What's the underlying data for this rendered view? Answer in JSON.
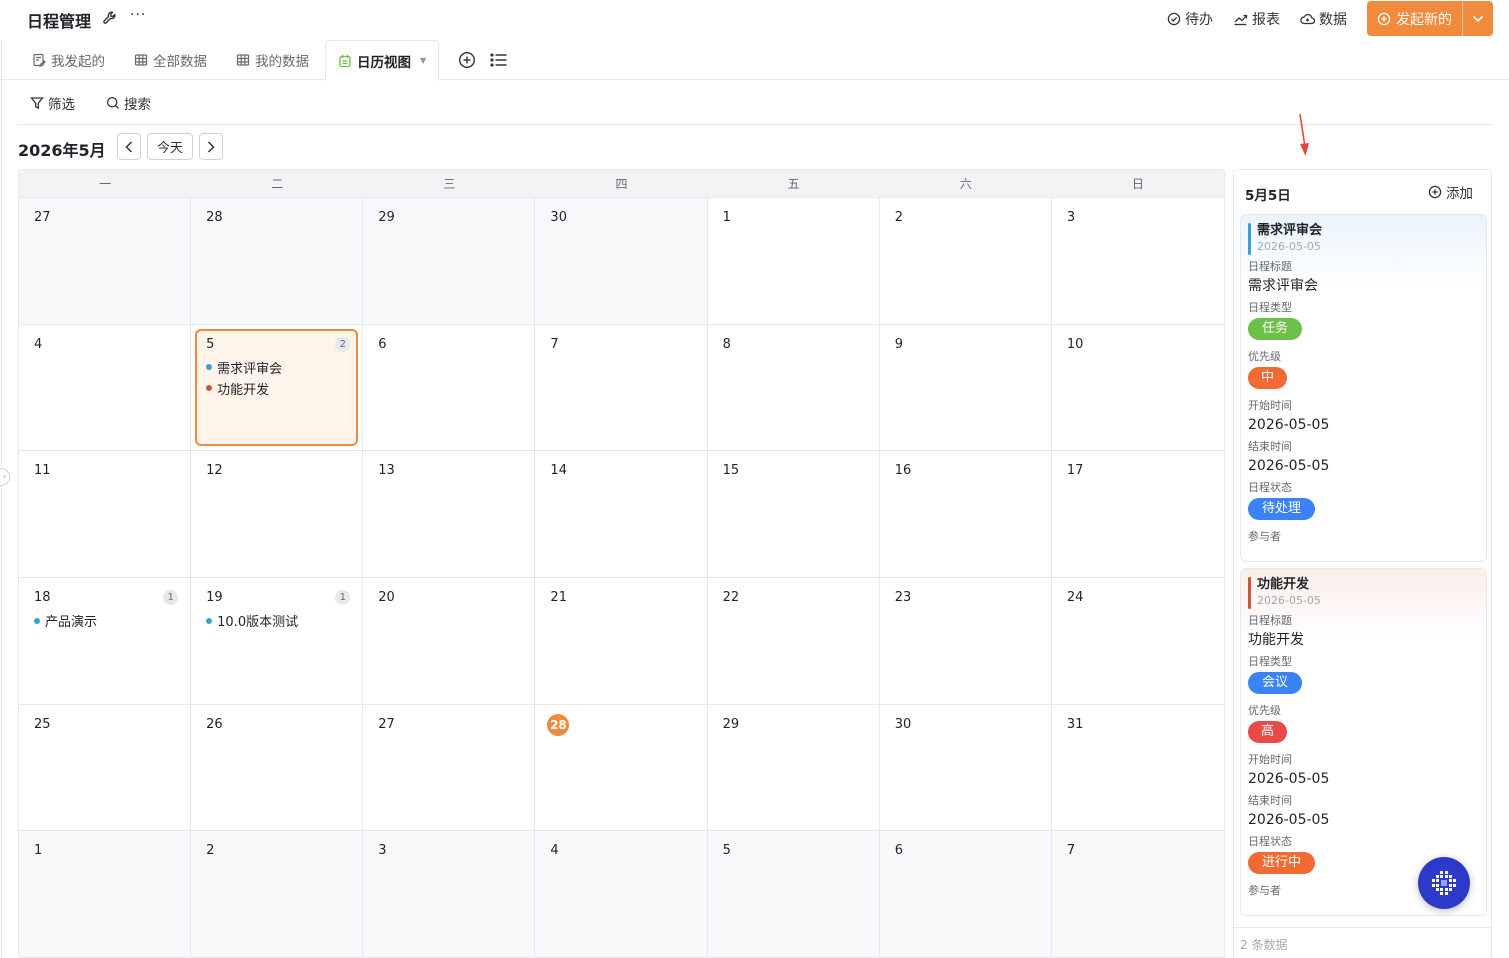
{
  "header": {
    "title": "日程管理",
    "more_glyph": "···",
    "links": [
      {
        "icon": "check-circle-icon",
        "label": "待办"
      },
      {
        "icon": "chart-trend-icon",
        "label": "报表"
      },
      {
        "icon": "cloud-icon",
        "label": "数据"
      }
    ],
    "primary_label": "发起新的"
  },
  "tabs": [
    {
      "label": "我发起的",
      "icon": "edit-doc-icon"
    },
    {
      "label": "全部数据",
      "icon": "table-icon"
    },
    {
      "label": "我的数据",
      "icon": "table-icon"
    },
    {
      "label": "日历视图",
      "icon": "calendar-icon",
      "active": true
    }
  ],
  "filterbar": {
    "filter_label": "筛选",
    "search_label": "搜索"
  },
  "calendar": {
    "month_title": "2026年5月",
    "today_label": "今天",
    "weekdays": [
      "一",
      "二",
      "三",
      "四",
      "五",
      "六",
      "日"
    ],
    "accent_color": "#f08a3c",
    "days": [
      {
        "d": "27",
        "other": true
      },
      {
        "d": "28",
        "other": true
      },
      {
        "d": "29",
        "other": true
      },
      {
        "d": "30",
        "other": true
      },
      {
        "d": "1"
      },
      {
        "d": "2"
      },
      {
        "d": "3"
      },
      {
        "d": "4"
      },
      {
        "d": "5",
        "selected": true,
        "count": "2",
        "events": [
          {
            "title": "需求评审会",
            "color": "#3d9fd1"
          },
          {
            "title": "功能开发",
            "color": "#c9583a"
          }
        ]
      },
      {
        "d": "6"
      },
      {
        "d": "7"
      },
      {
        "d": "8"
      },
      {
        "d": "9"
      },
      {
        "d": "10"
      },
      {
        "d": "11"
      },
      {
        "d": "12"
      },
      {
        "d": "13"
      },
      {
        "d": "14"
      },
      {
        "d": "15"
      },
      {
        "d": "16"
      },
      {
        "d": "17"
      },
      {
        "d": "18",
        "count": "1",
        "events": [
          {
            "title": "产品演示",
            "color": "#3d9fd1"
          }
        ]
      },
      {
        "d": "19",
        "count": "1",
        "events": [
          {
            "title": "10.0版本测试",
            "color": "#3d9fd1"
          }
        ]
      },
      {
        "d": "20"
      },
      {
        "d": "21"
      },
      {
        "d": "22"
      },
      {
        "d": "23"
      },
      {
        "d": "24"
      },
      {
        "d": "25"
      },
      {
        "d": "26"
      },
      {
        "d": "27"
      },
      {
        "d": "28",
        "today": true
      },
      {
        "d": "29"
      },
      {
        "d": "30"
      },
      {
        "d": "31"
      },
      {
        "d": "1",
        "other": true
      },
      {
        "d": "2",
        "other": true
      },
      {
        "d": "3",
        "other": true
      },
      {
        "d": "4",
        "other": true
      },
      {
        "d": "5",
        "other": true
      },
      {
        "d": "6",
        "other": true
      },
      {
        "d": "7",
        "other": true
      }
    ]
  },
  "panel": {
    "date_title": "5月5日",
    "add_label": "添加",
    "cards": [
      {
        "title": "需求评审会",
        "date": "2026-05-05",
        "bar_color": "#3d9fd1",
        "title_label": "日程标题",
        "title_value": "需求评审会",
        "type_label": "日程类型",
        "type_value": "任务",
        "type_color": "#6cc04a",
        "priority_label": "优先级",
        "priority_value": "中",
        "priority_color": "#ef6b33",
        "start_label": "开始时间",
        "start_value": "2026-05-05",
        "end_label": "结束时间",
        "end_value": "2026-05-05",
        "status_label": "日程状态",
        "status_value": "待处理",
        "status_color": "#3b82f6",
        "participants_label": "参与者"
      },
      {
        "title": "功能开发",
        "date": "2026-05-05",
        "bar_color": "#c9583a",
        "title_label": "日程标题",
        "title_value": "功能开发",
        "type_label": "日程类型",
        "type_value": "会议",
        "type_color": "#3b82f6",
        "priority_label": "优先级",
        "priority_value": "高",
        "priority_color": "#e84a4a",
        "start_label": "开始时间",
        "start_value": "2026-05-05",
        "end_label": "结束时间",
        "end_value": "2026-05-05",
        "status_label": "日程状态",
        "status_value": "进行中",
        "status_color": "#ef6b33",
        "participants_label": "参与者"
      }
    ],
    "footer": "2 条数据"
  }
}
